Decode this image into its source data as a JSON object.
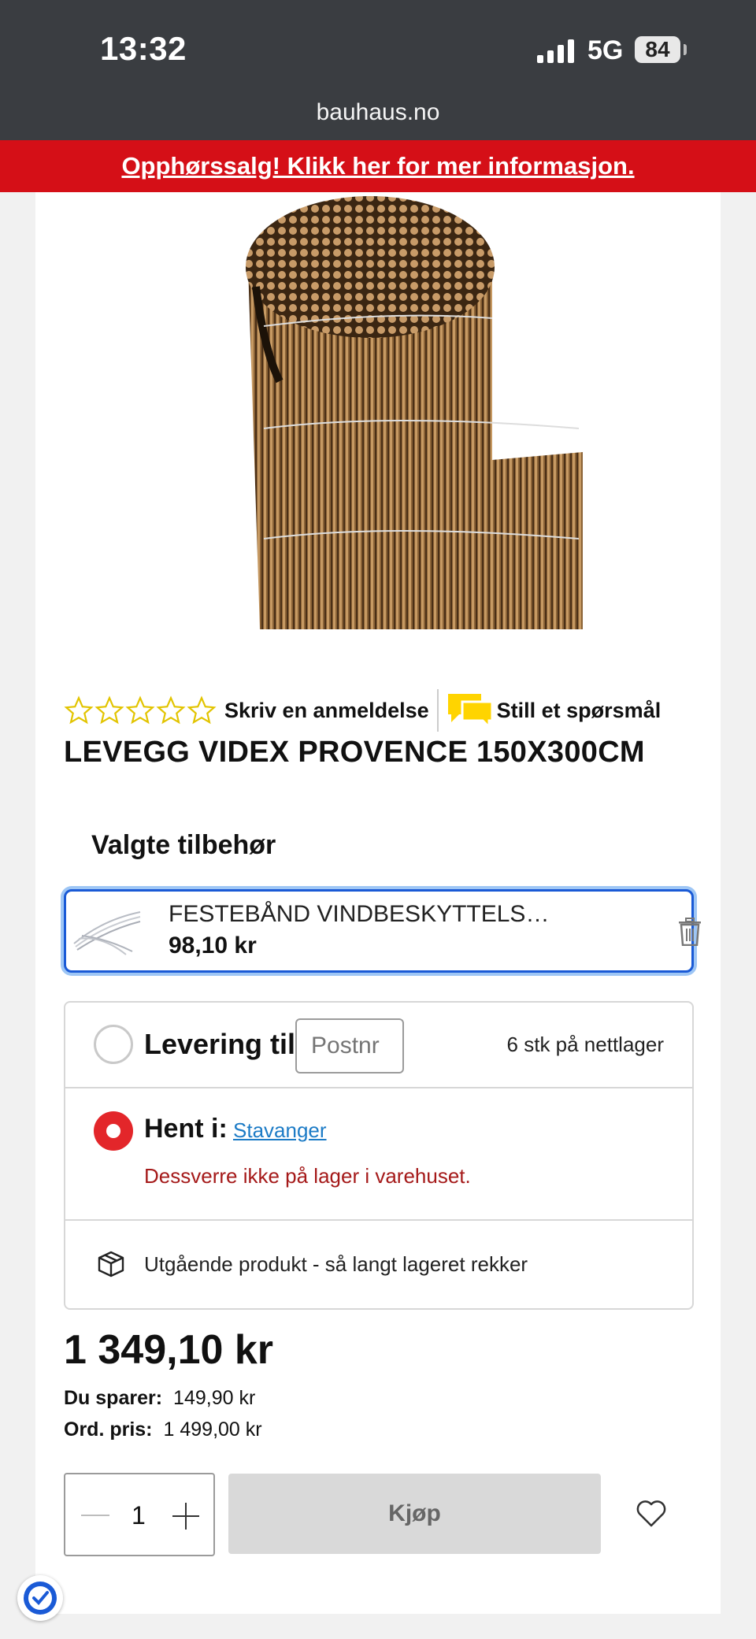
{
  "status_bar": {
    "time": "13:32",
    "network": "5G",
    "battery": "84"
  },
  "browser": {
    "url": "bauhaus.no"
  },
  "promo": {
    "text": "Opphørssalg! Klikk her for mer informasjon."
  },
  "product": {
    "rating_stars": 0,
    "write_review": "Skriv en anmeldelse",
    "ask_question": "Still et spørsmål",
    "title": "LEVEGG VIDEX PROVENCE 150X300CM"
  },
  "accessories": {
    "heading": "Valgte tilbehør",
    "item": {
      "name": "FESTEBÅND VINDBESKYTTELS…",
      "price": "98,10 kr"
    }
  },
  "delivery": {
    "label": "Levering til:",
    "postnr_placeholder": "Postnr",
    "stock": "6 stk på nettlager",
    "pickup_label": "Hent i:",
    "store": "Stavanger",
    "unavailable": "Dessverre ikke på lager i varehuset.",
    "outgoing": "Utgående produkt - så langt lageret rekker"
  },
  "pricing": {
    "price": "1 349,10 kr",
    "save_label": "Du sparer:",
    "save_value": "149,90 kr",
    "ord_label": "Ord. pris:",
    "ord_value": "1 499,00 kr"
  },
  "cart": {
    "quantity": "1",
    "buy_label": "Kjøp"
  },
  "colors": {
    "promo_red": "#d50f17",
    "radio_red": "#e3262a",
    "link_blue": "#1c7bc6",
    "star_yellow": "#f2d600",
    "chat_yellow": "#ffd400"
  }
}
